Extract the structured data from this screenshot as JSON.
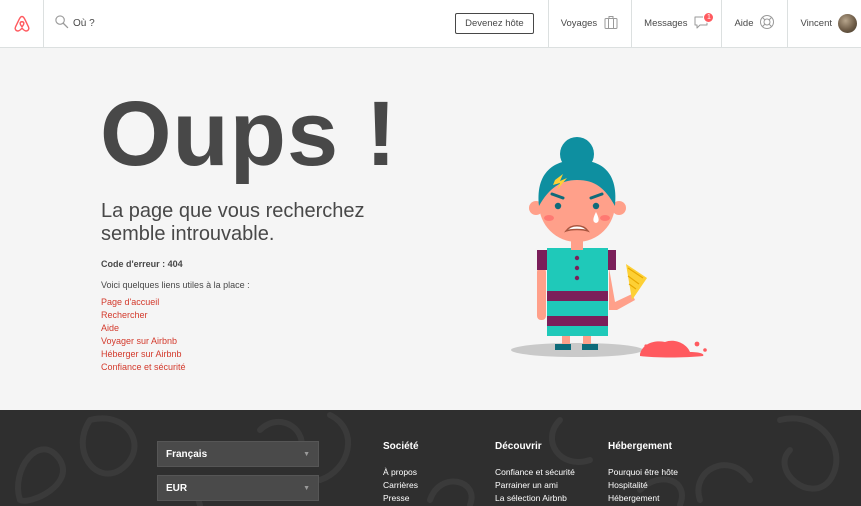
{
  "header": {
    "search_placeholder": "Où ?",
    "host_button": "Devenez hôte",
    "nav": {
      "trips": "Voyages",
      "messages": "Messages",
      "messages_badge": "1",
      "help": "Aide",
      "user": "Vincent"
    }
  },
  "main": {
    "title": "Oups !",
    "subtitle": "La page que vous recherchez semble introuvable.",
    "error_code": "Code d'erreur : 404",
    "links_intro": "Voici quelques liens utiles à la place :",
    "links": [
      "Page d'accueil",
      "Rechercher",
      "Aide",
      "Voyager sur Airbnb",
      "Héberger sur Airbnb",
      "Confiance et sécurité"
    ]
  },
  "footer": {
    "language": "Français",
    "currency": "EUR",
    "columns": [
      {
        "title": "Société",
        "items": [
          "À propos",
          "Carrières",
          "Presse"
        ]
      },
      {
        "title": "Découvrir",
        "items": [
          "Confiance et sécurité",
          "Parrainer un ami",
          "La sélection Airbnb"
        ]
      },
      {
        "title": "Hébergement",
        "items": [
          "Pourquoi être hôte",
          "Hospitalité",
          "Hébergement"
        ]
      }
    ]
  },
  "colors": {
    "brand": "#ff5a5f",
    "link": "#d33a2c",
    "text": "#484848",
    "footer_bg": "#2f2f2f",
    "teal": "#1fc9b9",
    "purple": "#7b1f5a"
  },
  "icons": [
    "airbnb-logo-icon",
    "search-icon",
    "suitcase-icon",
    "message-bubble-icon",
    "lifebuoy-icon",
    "chevron-down-icon"
  ]
}
